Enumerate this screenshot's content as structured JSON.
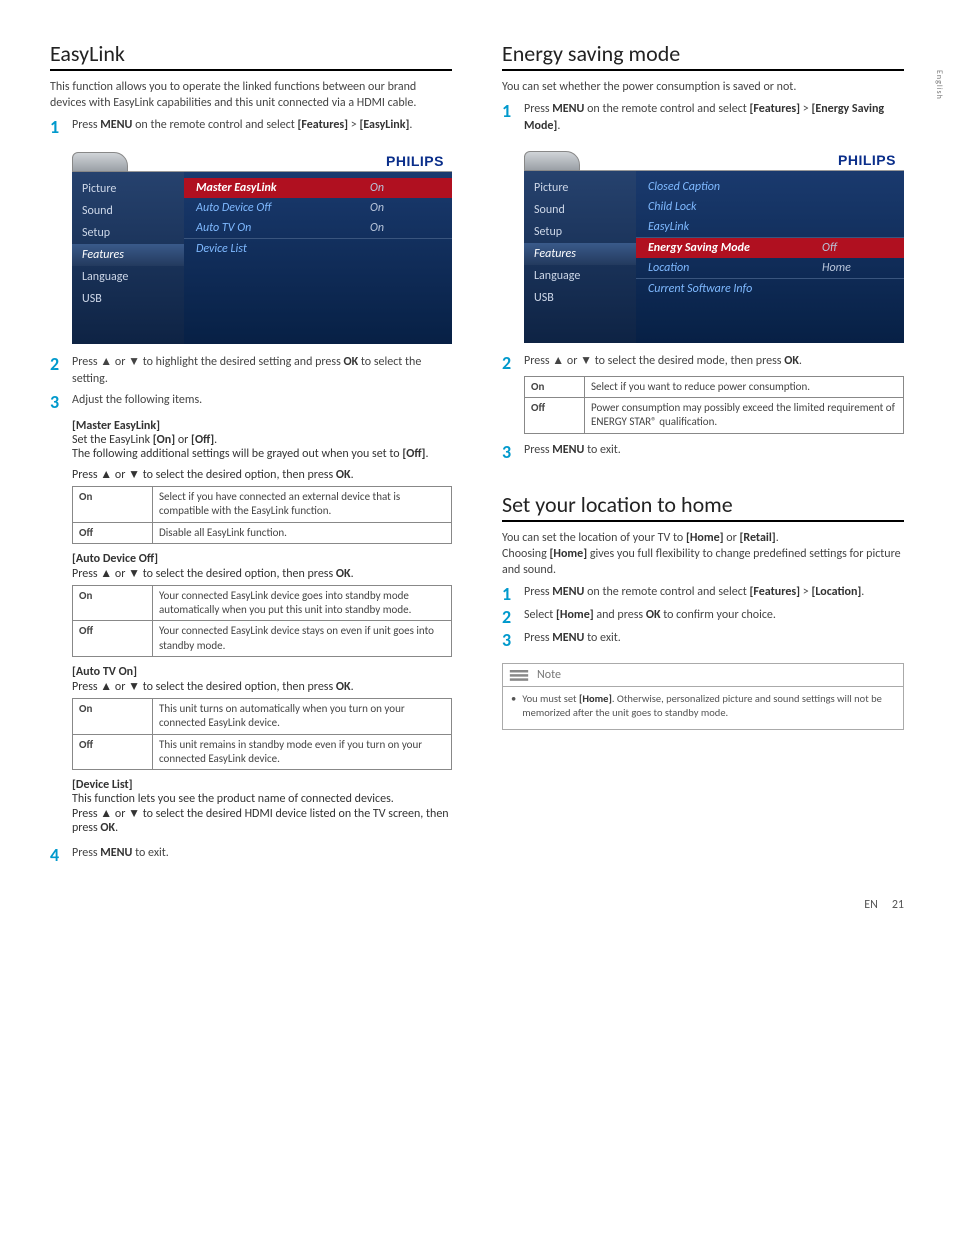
{
  "side_tab": "English",
  "footer": {
    "lang": "EN",
    "page": "21"
  },
  "left": {
    "heading": "EasyLink",
    "intro": "This function allows you to operate the linked functions between our brand devices with EasyLink capabilities and this unit connected via a HDMI cable.",
    "step1_a": "Press ",
    "step1_b": "MENU",
    "step1_c": " on the remote control and select ",
    "step1_d": "[Features]",
    "step1_e": " > ",
    "step1_f": "[EasyLink]",
    "step1_g": ".",
    "osd": {
      "brand": "PHILIPS",
      "nav": [
        "Picture",
        "Sound",
        "Setup",
        "Features",
        "Language",
        "USB"
      ],
      "nav_active": 3,
      "rows": [
        {
          "label": "Master EasyLink",
          "val": "On",
          "hl": true
        },
        {
          "label": "Auto Device Off",
          "val": "On"
        },
        {
          "label": "Auto TV On",
          "val": "On",
          "border": true
        },
        {
          "label": "Device List",
          "val": ""
        }
      ]
    },
    "step2_a": "Press ▲ or ▼ to highlight the desired setting and press ",
    "step2_b": "OK",
    "step2_c": " to select the setting.",
    "step3": "Adjust the following items.",
    "master": {
      "title": "[Master EasyLink]",
      "line1_a": "Set the EasyLink ",
      "line1_b": "[On]",
      "line1_c": " or ",
      "line1_d": "[Off]",
      "line1_e": ".",
      "line2_a": "The following additional settings will be grayed out when you set to ",
      "line2_b": "[Off]",
      "line2_c": ".",
      "prompt_a": "Press ▲ or ▼ to select the desired option, then press ",
      "prompt_b": "OK",
      "prompt_c": ".",
      "opts": [
        {
          "k": "On",
          "v": "Select if you have connected an external device that is compatible with the EasyLink function."
        },
        {
          "k": "Off",
          "v": "Disable all EasyLink function."
        }
      ]
    },
    "autooff": {
      "title": "[Auto Device Off]",
      "prompt_a": "Press ▲ or ▼ to select the desired option, then press ",
      "prompt_b": "OK",
      "prompt_c": ".",
      "opts": [
        {
          "k": "On",
          "v": "Your connected EasyLink device goes into standby mode automatically when you put this unit into standby mode."
        },
        {
          "k": "Off",
          "v": "Your connected EasyLink device stays on even if unit goes into standby mode."
        }
      ]
    },
    "autotv": {
      "title": "[Auto TV On]",
      "prompt_a": "Press ▲ or ▼ to select the desired option, then press ",
      "prompt_b": "OK",
      "prompt_c": ".",
      "opts": [
        {
          "k": "On",
          "v": "This unit turns on automatically when you turn on your connected EasyLink device."
        },
        {
          "k": "Off",
          "v": "This unit remains in standby mode even if you turn on your connected EasyLink device."
        }
      ]
    },
    "devlist": {
      "title": "[Device List]",
      "line1": "This function lets you see the product name of connected devices.",
      "line2_a": "Press ▲ or ▼ to select the desired HDMI device listed on the TV screen, then press ",
      "line2_b": "OK",
      "line2_c": "."
    },
    "step4_a": "Press ",
    "step4_b": "MENU",
    "step4_c": " to exit."
  },
  "right_energy": {
    "heading": "Energy saving mode",
    "intro": "You can set whether the power consumption is saved or not.",
    "step1_a": "Press ",
    "step1_b": "MENU",
    "step1_c": " on the remote control and select ",
    "step1_d": "[Features]",
    "step1_e": " > ",
    "step1_f": "[Energy Saving Mode]",
    "step1_g": ".",
    "osd": {
      "brand": "PHILIPS",
      "nav": [
        "Picture",
        "Sound",
        "Setup",
        "Features",
        "Language",
        "USB"
      ],
      "nav_active": 3,
      "rows": [
        {
          "label": "Closed Caption",
          "val": ""
        },
        {
          "label": "Child Lock",
          "val": ""
        },
        {
          "label": "EasyLink",
          "val": "",
          "border": true
        },
        {
          "label": "Energy Saving Mode",
          "val": "Off",
          "hl": true
        },
        {
          "label": "Location",
          "val": "Home",
          "border": true
        },
        {
          "label": "Current Software Info",
          "val": ""
        }
      ]
    },
    "step2_a": "Press ▲ or ▼ to select the desired mode, then press ",
    "step2_b": "OK",
    "step2_c": ".",
    "opts": [
      {
        "k": "On",
        "v": "Select if you want to reduce power consumption."
      },
      {
        "k": "Off",
        "v": "Power consumption may possibly exceed the limited requirement of ENERGY STAR® qualification."
      }
    ],
    "step3_a": "Press ",
    "step3_b": "MENU",
    "step3_c": " to exit."
  },
  "right_loc": {
    "heading": "Set your location to home",
    "intro_a": "You can set the location of your TV to ",
    "intro_b": "[Home]",
    "intro_c": " or ",
    "intro_d": "[Retail]",
    "intro_e": ".",
    "intro2_a": "Choosing ",
    "intro2_b": "[Home]",
    "intro2_c": " gives you full flexibility to change predefined settings for picture and sound.",
    "step1_a": "Press ",
    "step1_b": "MENU",
    "step1_c": " on the remote control and select ",
    "step1_d": "[Features]",
    "step1_e": " > ",
    "step1_f": "[Location]",
    "step1_g": ".",
    "step2_a": "Select ",
    "step2_b": "[Home]",
    "step2_c": " and press ",
    "step2_d": "OK",
    "step2_e": " to confirm your choice.",
    "step3_a": "Press ",
    "step3_b": "MENU",
    "step3_c": " to exit.",
    "note_label": "Note",
    "note_a": "You must set ",
    "note_b": "[Home]",
    "note_c": ". Otherwise, personalized picture and sound settings will not be memorized after the unit goes to standby mode."
  }
}
